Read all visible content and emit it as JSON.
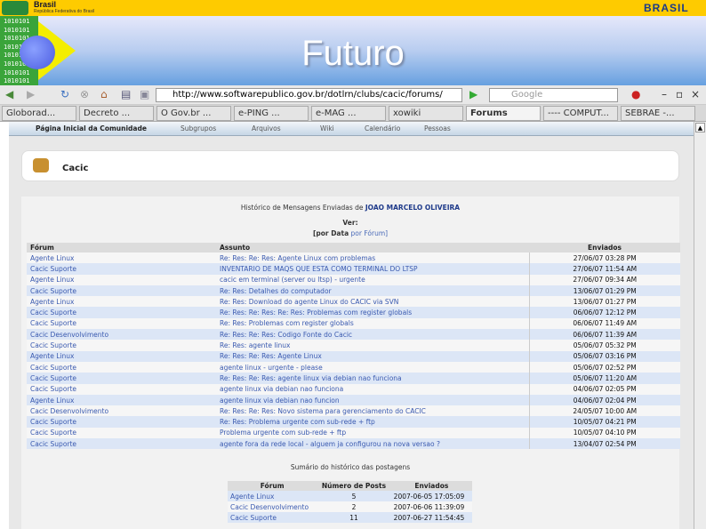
{
  "header": {
    "brand": "Brasil",
    "subtitle": "República Federativa do Brasil",
    "logo_text": "BRASIL",
    "banner_title": "Futuro",
    "binary_text": "1010101\n1010101\n1010101\n1010101\n1010101\n1010101\n1010101\n1010101"
  },
  "browser": {
    "url": "http://www.softwarepublico.gov.br/dotlrn/clubs/cacic/forums/",
    "search_placeholder": "Google",
    "tabs": [
      {
        "label": "Globorad..."
      },
      {
        "label": "Decreto ..."
      },
      {
        "label": "O Gov.br ..."
      },
      {
        "label": "e-PING ..."
      },
      {
        "label": "e-MAG ..."
      },
      {
        "label": "xowiki"
      },
      {
        "label": "Forums"
      },
      {
        "label": "---- COMPUT..."
      },
      {
        "label": "SEBRAE -..."
      }
    ]
  },
  "nav": [
    "Página Inicial da Comunidade",
    "Subgrupos",
    "Arquivos",
    "Wiki",
    "Calendário",
    "Pessoas"
  ],
  "community": "Cacic",
  "history": {
    "title_prefix": "Histórico de Mensagens Enviadas de",
    "user": "JOAO MARCELO OLIVEIRA",
    "ver": "Ver:",
    "by_date": "[por Data",
    "by_forum": "por Fórum]",
    "columns": [
      "Fórum",
      "Assunto",
      "Enviados"
    ],
    "rows": [
      [
        "Agente Linux",
        "Re: Res: Re: Res: Agente Linux com problemas",
        "27/06/07 03:28 PM"
      ],
      [
        "Cacic Suporte",
        "INVENTARIO DE MAQS QUE ESTA COMO TERMINAL DO LTSP",
        "27/06/07 11:54 AM"
      ],
      [
        "Agente Linux",
        "cacic em terminal (server ou ltsp) - urgente",
        "27/06/07 09:34 AM"
      ],
      [
        "Cacic Suporte",
        "Re: Res: Detalhes do computador",
        "13/06/07 01:29 PM"
      ],
      [
        "Agente Linux",
        "Re: Res: Download do agente Linux do CACIC via SVN",
        "13/06/07 01:27 PM"
      ],
      [
        "Cacic Suporte",
        "Re: Res: Re: Res: Re: Res: Problemas com register globals",
        "06/06/07 12:12 PM"
      ],
      [
        "Cacic Suporte",
        "Re: Res: Problemas com register globals",
        "06/06/07 11:49 AM"
      ],
      [
        "Cacic Desenvolvimento",
        "Re: Res: Re: Res: Codigo Fonte do Cacic",
        "06/06/07 11:39 AM"
      ],
      [
        "Cacic Suporte",
        "Re: Res: agente linux",
        "05/06/07 05:32 PM"
      ],
      [
        "Agente Linux",
        "Re: Res: Re: Res: Agente Linux",
        "05/06/07 03:16 PM"
      ],
      [
        "Cacic Suporte",
        "agente linux - urgente - please",
        "05/06/07 02:52 PM"
      ],
      [
        "Cacic Suporte",
        "Re: Res: Re: Res: agente linux via debian nao funciona",
        "05/06/07 11:20 AM"
      ],
      [
        "Cacic Suporte",
        "agente linux via debian nao funciona",
        "04/06/07 02:05 PM"
      ],
      [
        "Agente Linux",
        "agente linux via debian nao funcion",
        "04/06/07 02:04 PM"
      ],
      [
        "Cacic Desenvolvimento",
        "Re: Res: Re: Res: Novo sistema para gerenciamento do CACIC",
        "24/05/07 10:00 AM"
      ],
      [
        "Cacic Suporte",
        "Re: Res: Problema urgente com sub-rede + ftp",
        "10/05/07 04:21 PM"
      ],
      [
        "Cacic Suporte",
        "Problema urgente com sub-rede + ftp",
        "10/05/07 04:10 PM"
      ],
      [
        "Cacic Suporte",
        "agente fora da rede local - alguem ja configurou na nova versao ?",
        "13/04/07 02:54 PM"
      ]
    ]
  },
  "summary": {
    "title": "Sumário do histórico das postagens",
    "columns": [
      "Fórum",
      "Número de Posts",
      "Enviados"
    ],
    "rows": [
      [
        "Agente Linux",
        "5",
        "2007-06-05 17:05:09"
      ],
      [
        "Cacic Desenvolvimento",
        "2",
        "2007-06-06 11:39:09"
      ],
      [
        "Cacic Suporte",
        "11",
        "2007-06-27 11:54:45"
      ]
    ]
  }
}
